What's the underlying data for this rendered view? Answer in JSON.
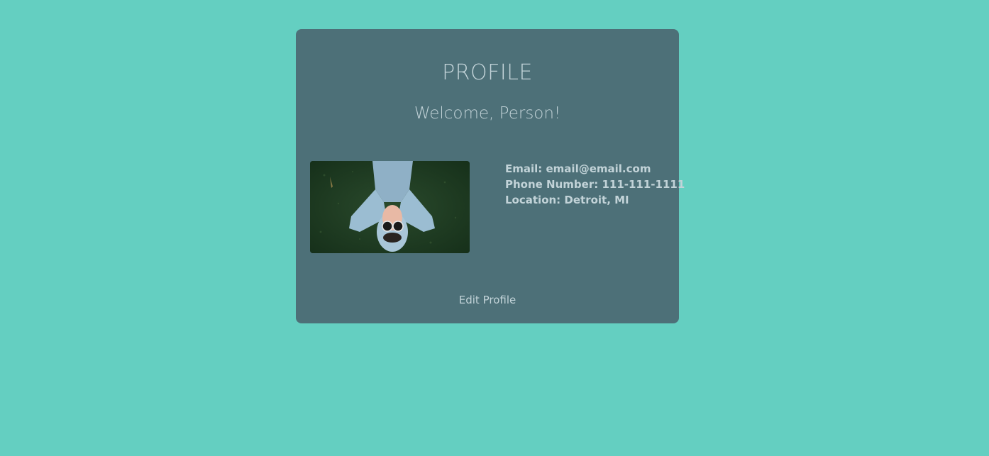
{
  "profile": {
    "title": "PROFILE",
    "welcome": "Welcome, Person!",
    "email": "Email: email@email.com",
    "phone": "Phone Number: 111-111-1111",
    "location": "Location: Detroit, MI",
    "edit_label": "Edit Profile",
    "photo_icon": "person-lying-on-grass-photo"
  },
  "colors": {
    "background": "#64cfc1",
    "card": "#4d7078",
    "text": "#c2d3d8"
  }
}
